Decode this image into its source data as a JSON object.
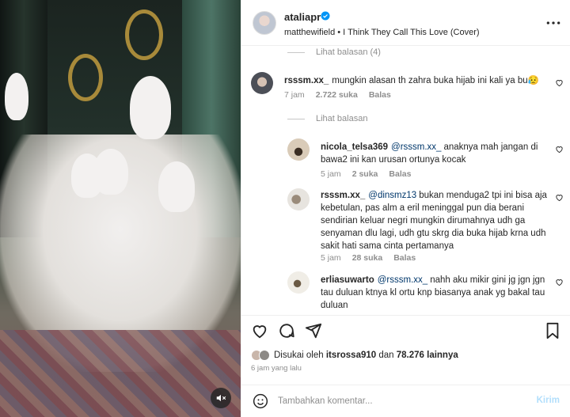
{
  "post": {
    "author": "ataliapr",
    "audio": "matthewifield • I Think They Call This Love (Cover)"
  },
  "comments": {
    "view_replies_top": "Lihat balasan (4)",
    "main": {
      "username": "rsssm.xx_",
      "text": "mungkin alasan th zahra buka hijab ini kali ya bu😥",
      "time": "7 jam",
      "likes": "2.722 suka",
      "reply": "Balas"
    },
    "view_replies": "Lihat balasan",
    "replies": [
      {
        "username": "nicola_telsa369",
        "mention": "@rsssm.xx_",
        "text": "anaknya mah jangan di bawa2 ini kan urusan ortunya kocak",
        "time": "5 jam",
        "likes": "2 suka",
        "reply": "Balas"
      },
      {
        "username": "rsssm.xx_",
        "mention": "@dinsmz13",
        "text": "bukan menduga2 tpi ini bisa aja kebetulan, pas alm a eril meninggal pun dia berani sendirian keluar negri mungkin dirumahnya udh ga senyaman dlu lagi, udh gtu skrg dia buka hijab krna udh sakit hati sama cinta pertamanya",
        "time": "5 jam",
        "likes": "28 suka",
        "reply": "Balas"
      },
      {
        "username": "erliasuwarto",
        "mention": "@rsssm.xx_",
        "text": "nahh aku mikir gini jg jgn jgn tau duluan ktnya kl ortu knp biasanya anak yg bakal tau duluan"
      }
    ]
  },
  "likes": {
    "prefix": "Disukai oleh",
    "user": "itsrossa910",
    "middle": "dan",
    "others": "78.276 lainnya"
  },
  "posted_time": "6 jam yang lalu",
  "add_comment": {
    "placeholder": "Tambahkan komentar...",
    "post_label": "Kirim"
  },
  "icons": {
    "verified": "verified-badge-icon",
    "more": "more-options-icon",
    "like": "heart-icon",
    "comment": "comment-icon",
    "share": "share-icon",
    "save": "bookmark-icon",
    "emoji": "emoji-icon",
    "mute": "muted-speaker-icon"
  },
  "colors": {
    "accent_blue": "#0095f6",
    "disabled_blue": "#b2dffc",
    "mention": "#00376b",
    "secondary_text": "#8e8e8e"
  }
}
